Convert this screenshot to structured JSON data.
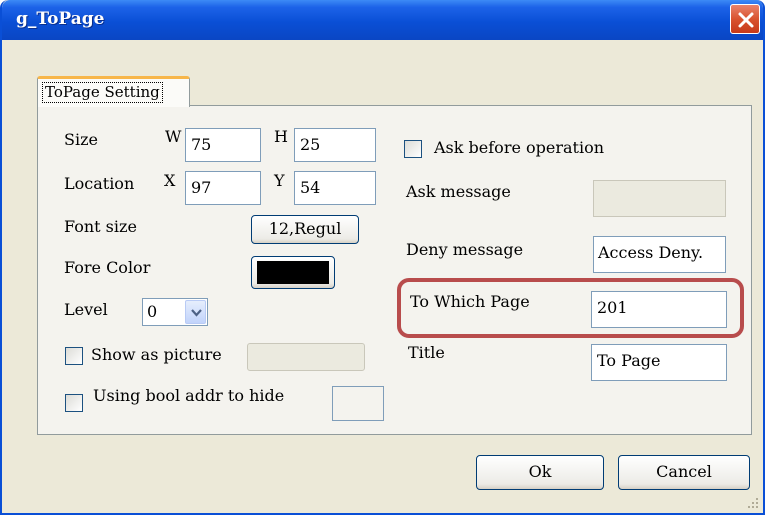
{
  "window": {
    "title": "g_ToPage"
  },
  "tab": {
    "label": "ToPage Setting"
  },
  "size": {
    "label": "Size",
    "w_label": "W",
    "w_value": "75",
    "h_label": "H",
    "h_value": "25"
  },
  "location": {
    "label": "Location",
    "x_label": "X",
    "x_value": "97",
    "y_label": "Y",
    "y_value": "54"
  },
  "font": {
    "label": "Font size",
    "button": "12,Regul"
  },
  "fore_color": {
    "label": "Fore Color",
    "color": "#000000"
  },
  "level": {
    "label": "Level",
    "value": "0"
  },
  "show_picture": {
    "label": "Show as picture",
    "checked": false,
    "value": ""
  },
  "bool_hide": {
    "label": "Using bool addr to hide",
    "checked": false,
    "value": ""
  },
  "ask_before": {
    "label": "Ask before operation",
    "checked": false
  },
  "ask_message": {
    "label": "Ask message",
    "value": ""
  },
  "deny_message": {
    "label": "Deny message",
    "value": "Access Deny."
  },
  "to_page": {
    "label": "To Which Page",
    "value": "201"
  },
  "title_field": {
    "label": "Title",
    "value": "To Page"
  },
  "buttons": {
    "ok": "Ok",
    "cancel": "Cancel"
  },
  "colors": {
    "titlebar": "#0a4fd6",
    "highlight": "#b84c4c",
    "dialog_bg": "#ece9d8"
  },
  "icons": {
    "close": "close-icon",
    "dropdown": "chevron-down-icon",
    "resize": "resize-grip-icon"
  }
}
